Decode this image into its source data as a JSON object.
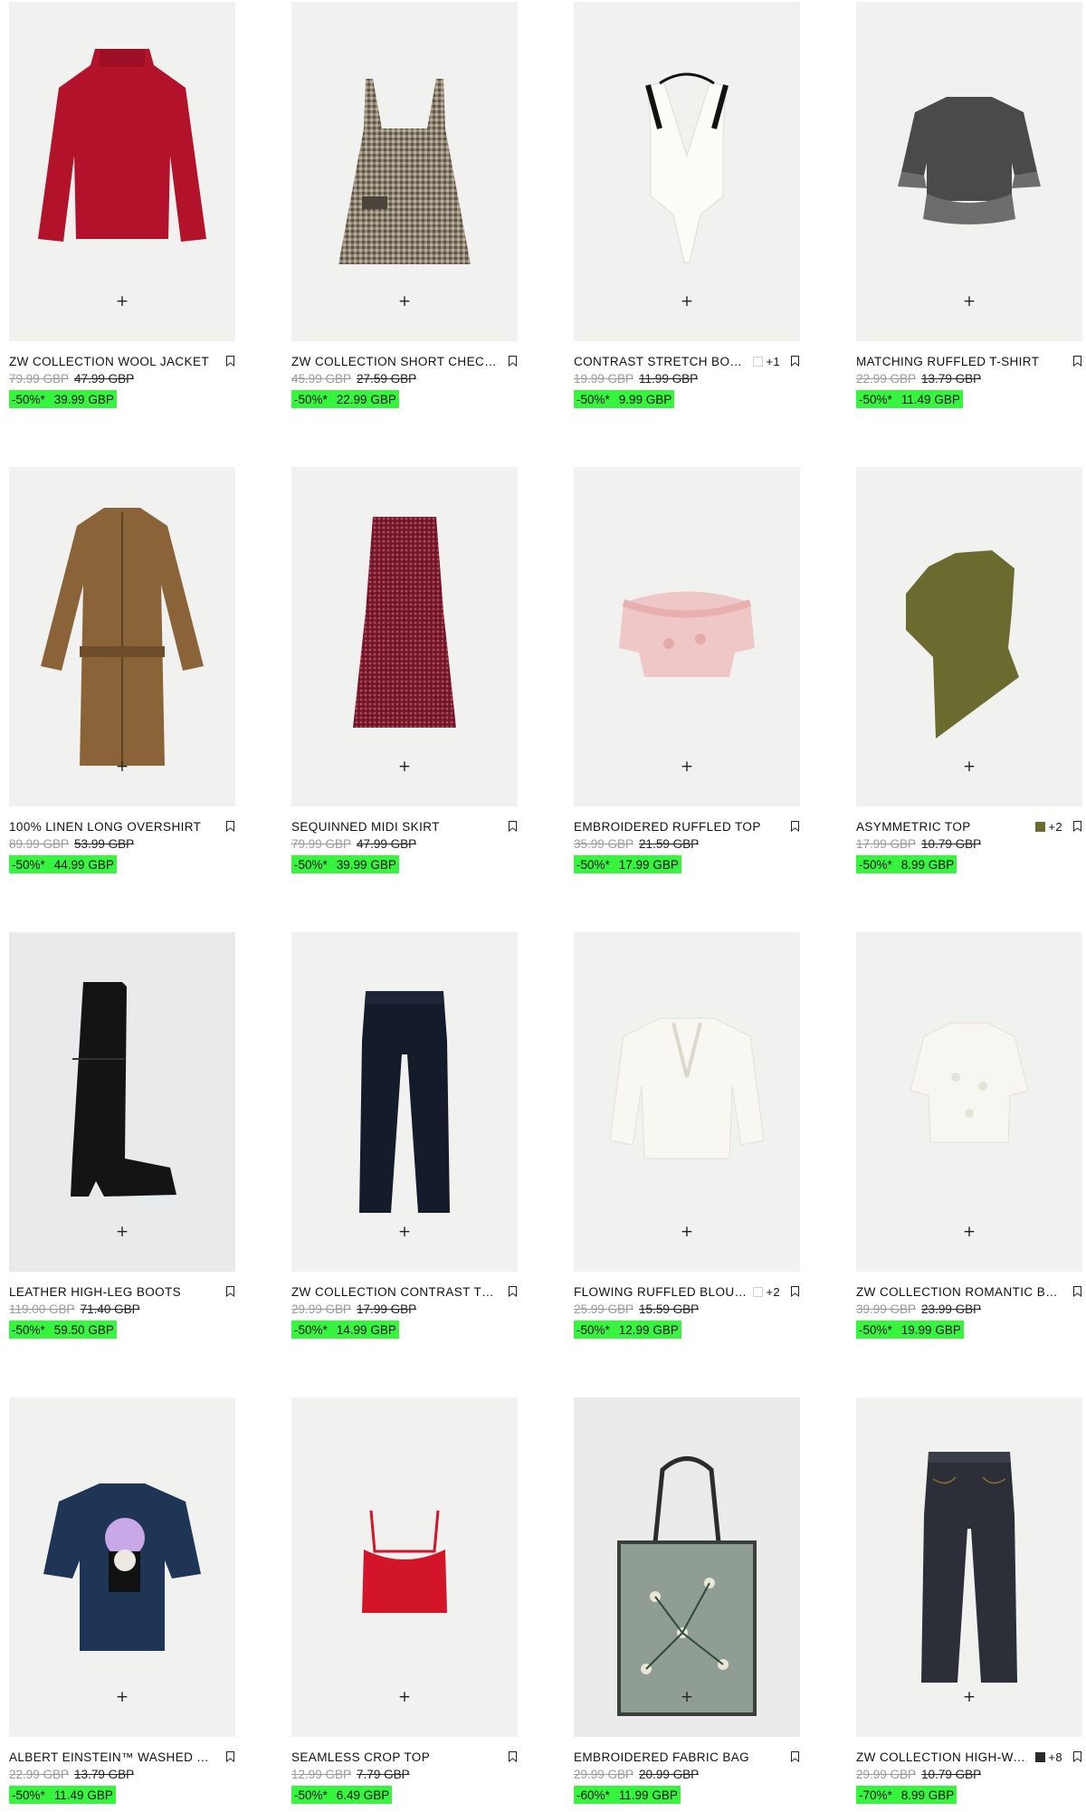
{
  "products": [
    {
      "name": "ZW COLLECTION WOOL JACKET",
      "swatch_color": "",
      "swatch_extra": "",
      "orig_price": "79.99 GBP",
      "prev_price": "47.99 GBP",
      "discount": "-50%*",
      "sale_price": "39.99 GBP",
      "image": "red-wool-jacket",
      "add_label": "+"
    },
    {
      "name": "ZW COLLECTION SHORT CHECK DRESS",
      "swatch_color": "",
      "swatch_extra": "",
      "orig_price": "45.99 GBP",
      "prev_price": "27.59 GBP",
      "discount": "-50%*",
      "sale_price": "22.99 GBP",
      "image": "check-pinafore-dress",
      "add_label": "+"
    },
    {
      "name": "CONTRAST STRETCH BODYSUIT",
      "swatch_color": "#ffffff",
      "swatch_extra": "+1",
      "orig_price": "19.99 GBP",
      "prev_price": "11.99 GBP",
      "discount": "-50%*",
      "sale_price": "9.99 GBP",
      "image": "white-halter-bodysuit",
      "add_label": "+"
    },
    {
      "name": "MATCHING RUFFLED T-SHIRT",
      "swatch_color": "",
      "swatch_extra": "",
      "orig_price": "22.99 GBP",
      "prev_price": "13.79 GBP",
      "discount": "-50%*",
      "sale_price": "11.49 GBP",
      "image": "grey-ruffle-tshirt",
      "add_label": "+"
    },
    {
      "name": "100% LINEN LONG OVERSHIRT",
      "swatch_color": "",
      "swatch_extra": "",
      "orig_price": "89.99 GBP",
      "prev_price": "53.99 GBP",
      "discount": "-50%*",
      "sale_price": "44.99 GBP",
      "image": "linen-overshirt",
      "add_label": "+"
    },
    {
      "name": "SEQUINNED MIDI SKIRT",
      "swatch_color": "",
      "swatch_extra": "",
      "orig_price": "79.99 GBP",
      "prev_price": "47.99 GBP",
      "discount": "-50%*",
      "sale_price": "39.99 GBP",
      "image": "sequin-skirt",
      "add_label": "+"
    },
    {
      "name": "EMBROIDERED RUFFLED TOP",
      "swatch_color": "",
      "swatch_extra": "",
      "orig_price": "35.99 GBP",
      "prev_price": "21.59 GBP",
      "discount": "-50%*",
      "sale_price": "17.99 GBP",
      "image": "pink-lace-top",
      "add_label": "+"
    },
    {
      "name": "ASYMMETRIC TOP",
      "swatch_color": "#6b6a2f",
      "swatch_extra": "+2",
      "orig_price": "17.99 GBP",
      "prev_price": "10.79 GBP",
      "discount": "-50%*",
      "sale_price": "8.99 GBP",
      "image": "khaki-asymmetric-top",
      "add_label": "+"
    },
    {
      "name": "LEATHER HIGH-LEG BOOTS",
      "swatch_color": "",
      "swatch_extra": "",
      "orig_price": "119.00 GBP",
      "prev_price": "71.40 GBP",
      "discount": "-50%*",
      "sale_price": "59.50 GBP",
      "image": "black-boots",
      "add_label": "+"
    },
    {
      "name": "ZW COLLECTION CONTRAST TROUSERS",
      "swatch_color": "",
      "swatch_extra": "",
      "orig_price": "29.99 GBP",
      "prev_price": "17.99 GBP",
      "discount": "-50%*",
      "sale_price": "14.99 GBP",
      "image": "navy-trousers",
      "add_label": "+"
    },
    {
      "name": "FLOWING RUFFLED BLOUSE",
      "swatch_color": "#ffffff",
      "swatch_extra": "+2",
      "orig_price": "25.99 GBP",
      "prev_price": "15.59 GBP",
      "discount": "-50%*",
      "sale_price": "12.99 GBP",
      "image": "white-ruffle-blouse",
      "add_label": "+"
    },
    {
      "name": "ZW COLLECTION ROMANTIC BLOUSE",
      "swatch_color": "",
      "swatch_extra": "",
      "orig_price": "39.99 GBP",
      "prev_price": "23.99 GBP",
      "discount": "-50%*",
      "sale_price": "19.99 GBP",
      "image": "white-lace-blouse",
      "add_label": "+"
    },
    {
      "name": "ALBERT EINSTEIN™ WASHED T-SHIRT",
      "swatch_color": "",
      "swatch_extra": "",
      "orig_price": "22.99 GBP",
      "prev_price": "13.79 GBP",
      "discount": "-50%*",
      "sale_price": "11.49 GBP",
      "image": "einstein-tshirt",
      "add_label": "+"
    },
    {
      "name": "SEAMLESS CROP TOP",
      "swatch_color": "",
      "swatch_extra": "",
      "orig_price": "12.99 GBP",
      "prev_price": "7.79 GBP",
      "discount": "-50%*",
      "sale_price": "6.49 GBP",
      "image": "red-crop-top",
      "add_label": "+"
    },
    {
      "name": "EMBROIDERED FABRIC BAG",
      "swatch_color": "",
      "swatch_extra": "",
      "orig_price": "29.99 GBP",
      "prev_price": "20.99 GBP",
      "discount": "-60%*",
      "sale_price": "11.99 GBP",
      "image": "embroidered-bag",
      "add_label": "+"
    },
    {
      "name": "ZW COLLECTION HIGH-WAIST JEANS",
      "swatch_color": "#2a2a2a",
      "swatch_extra": "+8",
      "orig_price": "29.99 GBP",
      "prev_price": "10.79 GBP",
      "discount": "-70%*",
      "sale_price": "8.99 GBP",
      "image": "dark-jeans",
      "add_label": "+"
    }
  ],
  "colors": {
    "sale_badge": "#37f43e",
    "image_bg": "#f1f1f0"
  }
}
